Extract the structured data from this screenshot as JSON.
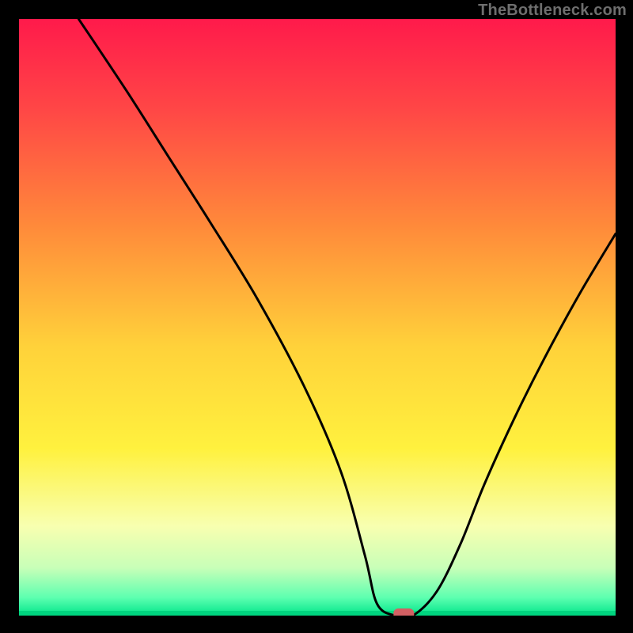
{
  "watermark": "TheBottleneck.com",
  "chart_data": {
    "type": "line",
    "title": "",
    "xlabel": "",
    "ylabel": "",
    "xlim": [
      0,
      100
    ],
    "ylim": [
      0,
      100
    ],
    "grid": false,
    "legend": false,
    "series": [
      {
        "name": "bottleneck-curve",
        "x": [
          10,
          18,
          25,
          32,
          40,
          48,
          54,
          58,
          60,
          63,
          66,
          70,
          74,
          78,
          83,
          88,
          94,
          100
        ],
        "y": [
          100,
          88,
          77,
          66,
          53,
          38,
          24,
          10,
          2,
          0,
          0,
          4,
          12,
          22,
          33,
          43,
          54,
          64
        ]
      }
    ],
    "marker": {
      "x": 64.5,
      "y": 0,
      "color": "#d26063",
      "label": "optimal-point"
    },
    "gradient_stops": [
      {
        "offset": 0.0,
        "color": "#ff1a4b"
      },
      {
        "offset": 0.15,
        "color": "#ff4646"
      },
      {
        "offset": 0.35,
        "color": "#ff8b3a"
      },
      {
        "offset": 0.55,
        "color": "#ffd23a"
      },
      {
        "offset": 0.72,
        "color": "#fff13e"
      },
      {
        "offset": 0.85,
        "color": "#f8ffb0"
      },
      {
        "offset": 0.92,
        "color": "#c8ffb8"
      },
      {
        "offset": 0.97,
        "color": "#5dffb0"
      },
      {
        "offset": 1.0,
        "color": "#00e58a"
      }
    ],
    "baseline_color": "#00d57f",
    "line_color": "#000000"
  }
}
